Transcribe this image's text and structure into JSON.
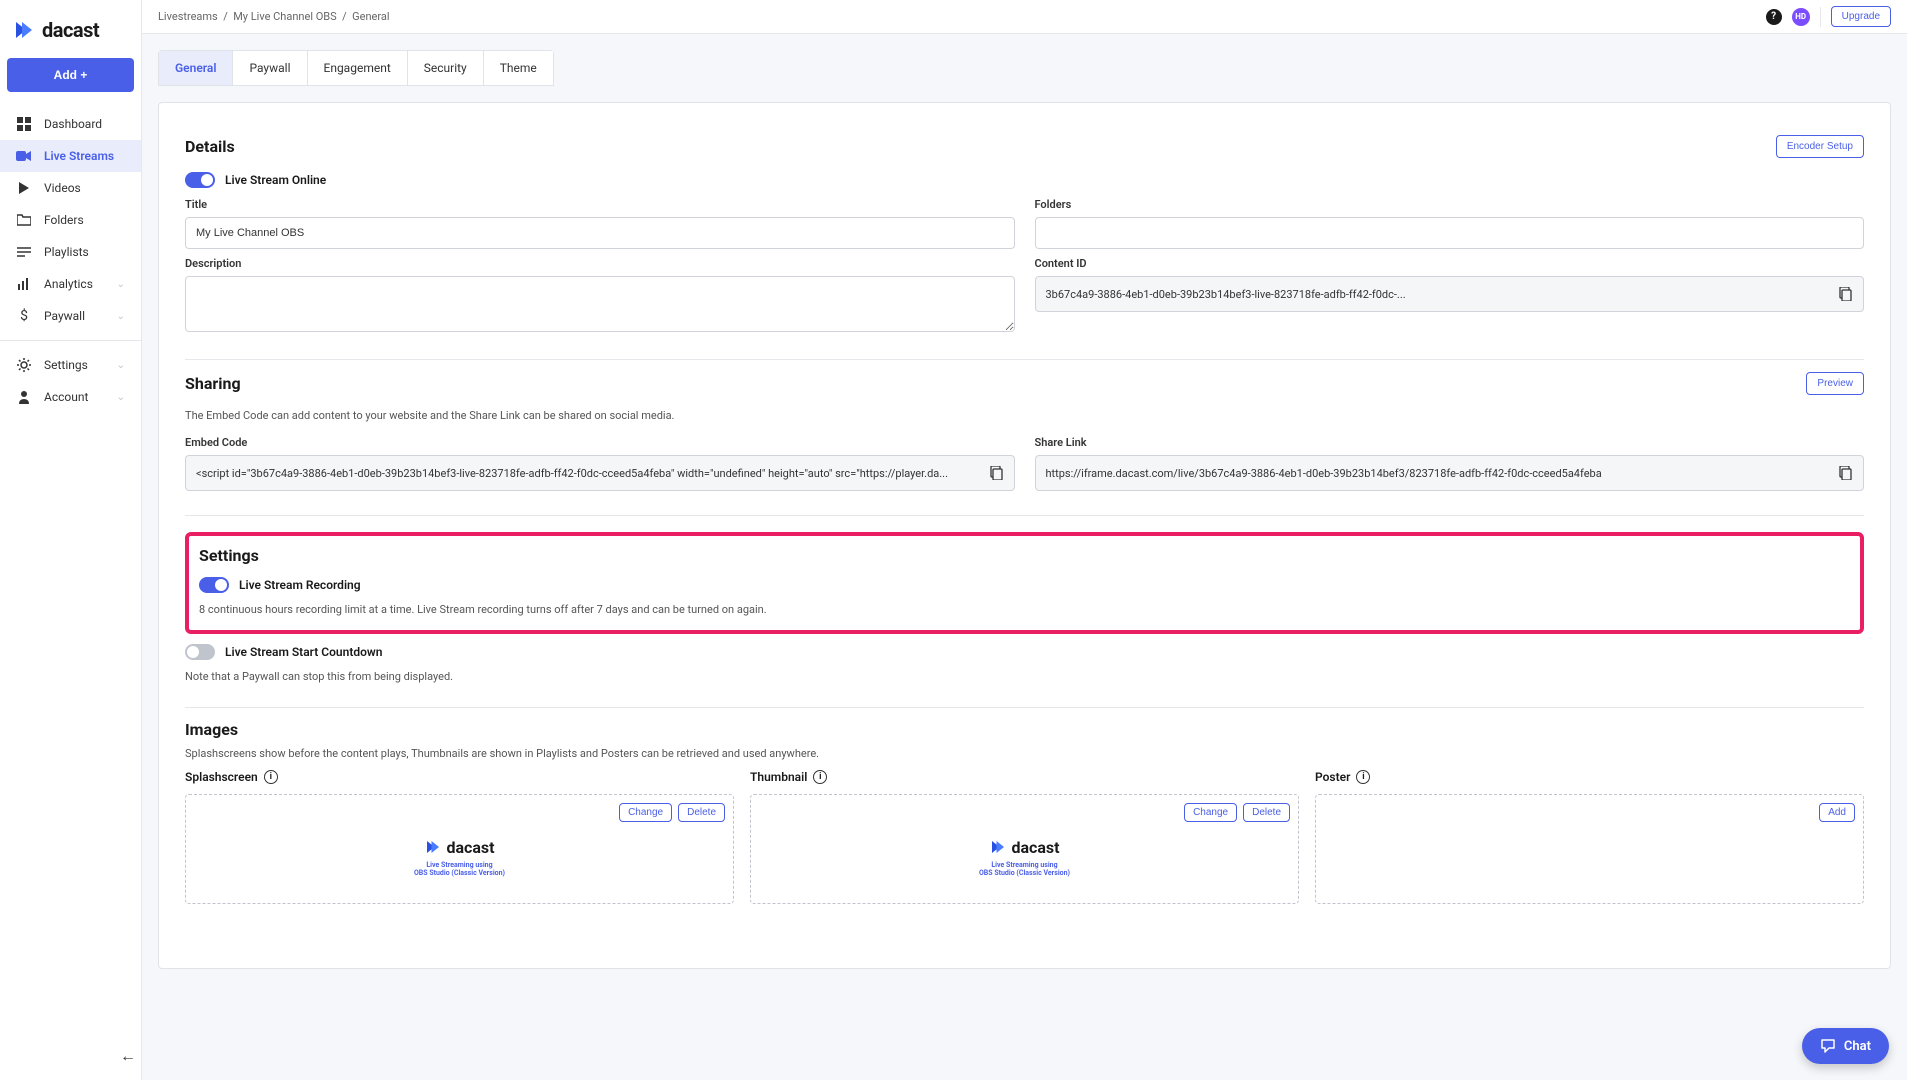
{
  "brand": {
    "name": "dacast"
  },
  "sidebar": {
    "add_label": "Add +",
    "items": [
      {
        "label": "Dashboard"
      },
      {
        "label": "Live Streams"
      },
      {
        "label": "Videos"
      },
      {
        "label": "Folders"
      },
      {
        "label": "Playlists"
      },
      {
        "label": "Analytics"
      },
      {
        "label": "Paywall"
      }
    ],
    "items2": [
      {
        "label": "Settings"
      },
      {
        "label": "Account"
      }
    ]
  },
  "breadcrumb": {
    "a": "Livestreams",
    "b": "My Live Channel OBS",
    "c": "General"
  },
  "topbar": {
    "avatar": "HD",
    "upgrade": "Upgrade"
  },
  "tabs": [
    {
      "label": "General"
    },
    {
      "label": "Paywall"
    },
    {
      "label": "Engagement"
    },
    {
      "label": "Security"
    },
    {
      "label": "Theme"
    }
  ],
  "details": {
    "heading": "Details",
    "encoder_btn": "Encoder Setup",
    "online_label": "Live Stream Online",
    "title_label": "Title",
    "title_value": "My Live Channel OBS",
    "folders_label": "Folders",
    "folders_value": "",
    "desc_label": "Description",
    "desc_value": "",
    "contentid_label": "Content ID",
    "contentid_value": "3b67c4a9-3886-4eb1-d0eb-39b23b14bef3-live-823718fe-adfb-ff42-f0dc-..."
  },
  "sharing": {
    "heading": "Sharing",
    "preview_btn": "Preview",
    "note": "The Embed Code can add content to your website and the Share Link can be shared on social media.",
    "embed_label": "Embed Code",
    "embed_value": "<script id=\"3b67c4a9-3886-4eb1-d0eb-39b23b14bef3-live-823718fe-adfb-ff42-f0dc-cceed5a4feba\" width=\"undefined\" height=\"auto\" src=\"https://player.da...",
    "link_label": "Share Link",
    "link_value": "https://iframe.dacast.com/live/3b67c4a9-3886-4eb1-d0eb-39b23b14bef3/823718fe-adfb-ff42-f0dc-cceed5a4feba"
  },
  "settings": {
    "heading": "Settings",
    "recording_label": "Live Stream Recording",
    "recording_note": "8 continuous hours recording limit at a time. Live Stream recording turns off after 7 days and can be turned on again.",
    "countdown_label": "Live Stream Start Countdown",
    "countdown_note": "Note that a Paywall can stop this from being displayed."
  },
  "images": {
    "heading": "Images",
    "note": "Splashscreens show before the content plays, Thumbnails are shown in Playlists and Posters can be retrieved and used anywhere.",
    "splash_label": "Splashscreen",
    "thumb_label": "Thumbnail",
    "poster_label": "Poster",
    "change_btn": "Change",
    "delete_btn": "Delete",
    "add_btn": "Add",
    "preview_brand": "dacast",
    "preview_sub1": "Live Streaming using",
    "preview_sub2": "OBS Studio (Classic Version)"
  },
  "chat": {
    "label": "Chat"
  }
}
